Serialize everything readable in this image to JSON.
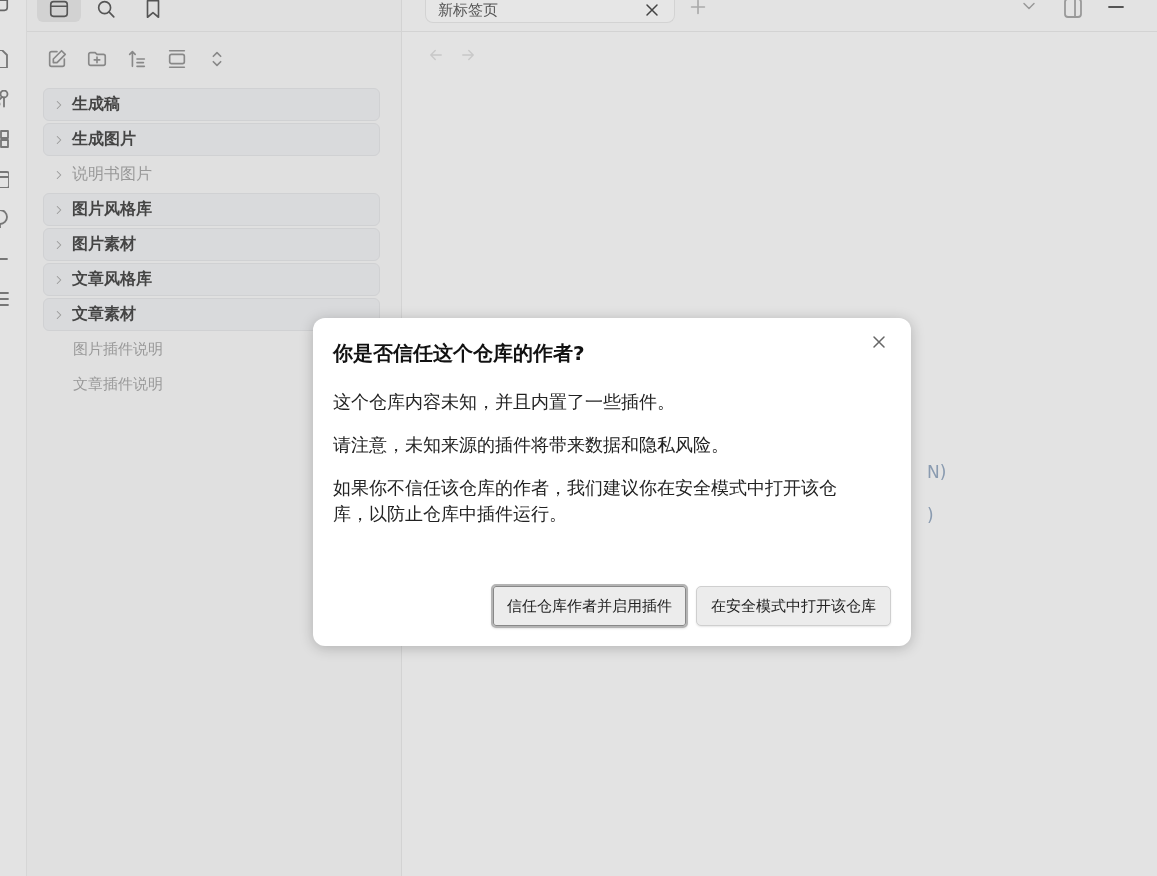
{
  "sidebar": {
    "tabs": [
      {
        "kind": "files",
        "selected": true
      },
      {
        "kind": "search",
        "selected": false
      },
      {
        "kind": "bookmarks",
        "selected": false
      }
    ],
    "tree": [
      {
        "kind": "folder",
        "label": "生成稿",
        "highlighted": true
      },
      {
        "kind": "folder",
        "label": "生成图片",
        "highlighted": true
      },
      {
        "kind": "folder",
        "label": "说明书图片",
        "highlighted": false
      },
      {
        "kind": "folder",
        "label": "图片风格库",
        "highlighted": true
      },
      {
        "kind": "folder",
        "label": "图片素材",
        "highlighted": true
      },
      {
        "kind": "folder",
        "label": "文章风格库",
        "highlighted": true
      },
      {
        "kind": "folder",
        "label": "文章素材",
        "highlighted": true
      },
      {
        "kind": "file",
        "label": "图片插件说明",
        "highlighted": false
      },
      {
        "kind": "file",
        "label": "文章插件说明",
        "highlighted": false
      }
    ]
  },
  "tabs": [
    {
      "title": "新标签页",
      "selected": true
    }
  ],
  "behind_dialog": [
    "N)",
    ")"
  ],
  "dialog": {
    "title": "你是否信任这个仓库的作者?",
    "paragraphs": [
      "这个仓库内容未知，并且内置了一些插件。",
      "请注意，未知来源的插件将带来数据和隐私风险。",
      "如果你不信任该仓库的作者，我们建议你在安全模式中打开该仓库，以防止仓库中插件运行。"
    ],
    "buttons": [
      {
        "label": "信任仓库作者并启用插件",
        "focused": true
      },
      {
        "label": "在安全模式中打开该仓库",
        "focused": false
      }
    ]
  }
}
